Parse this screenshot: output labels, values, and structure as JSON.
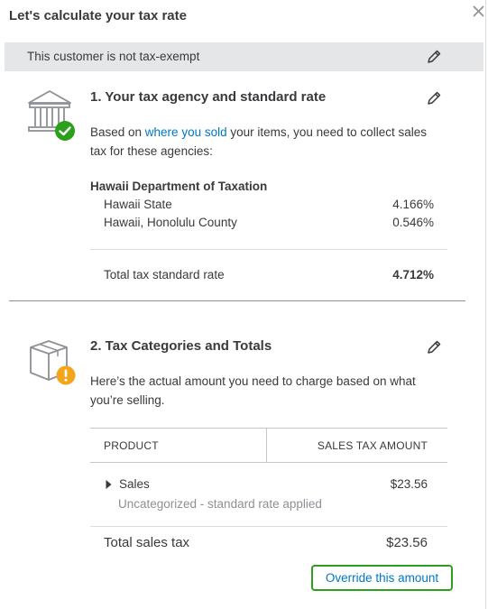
{
  "header": {
    "title": "Let's calculate your tax rate"
  },
  "banner": {
    "text": "This customer is not tax-exempt"
  },
  "agency_section": {
    "title": "1. Your tax agency and standard rate",
    "desc_prefix": "Based on ",
    "desc_link": "where you sold",
    "desc_suffix_line1": " your items, you need to collect sales",
    "desc_line2": "tax for these agencies:",
    "agency_name": "Hawaii Department of Taxation",
    "rates": [
      {
        "label": "Hawaii State",
        "value": "4.166%"
      },
      {
        "label": "Hawaii, Honolulu County",
        "value": "0.546%"
      }
    ],
    "total_label": "Total tax standard rate",
    "total_value": "4.712%",
    "status": "check"
  },
  "categories_section": {
    "title": "2. Tax Categories and Totals",
    "desc_line1": "Here’s the actual amount you need to charge based on what",
    "desc_line2": "you’re selling.",
    "status": "warning",
    "table": {
      "col_product": "PRODUCT",
      "col_amount": "SALES TAX AMOUNT",
      "rows": [
        {
          "product": "Sales",
          "sub": "Uncategorized - standard rate applied",
          "amount": "$23.56"
        }
      ],
      "total_label": "Total sales tax",
      "total_value": "$23.56"
    },
    "override_label": "Override this amount"
  },
  "colors": {
    "text": "#393a3d",
    "link": "#0077c5",
    "success": "#2ca01c",
    "warning": "#f4a51c",
    "banner_bg": "#e5e6e8"
  }
}
